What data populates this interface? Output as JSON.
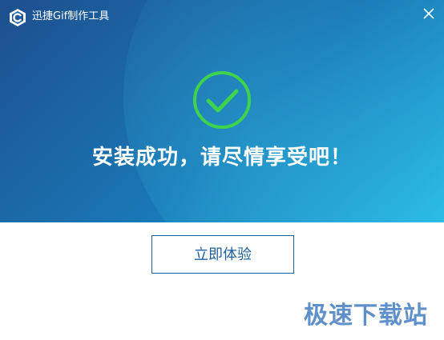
{
  "window": {
    "title": "迅捷Gif制作工具"
  },
  "icons": {
    "logo": "app-logo-icon",
    "close": "close-icon",
    "success": "check-circle-icon"
  },
  "colors": {
    "header_gradient_start": "#1d4f8e",
    "header_gradient_end": "#2bbde6",
    "check_green": "#3fd24c",
    "button_border": "#1c5f9c",
    "watermark": "#4f85c5"
  },
  "main": {
    "success_message": "安装成功，请尽情享受吧！",
    "primary_button_label": "立即体验"
  },
  "watermark_text": "极速下载站"
}
